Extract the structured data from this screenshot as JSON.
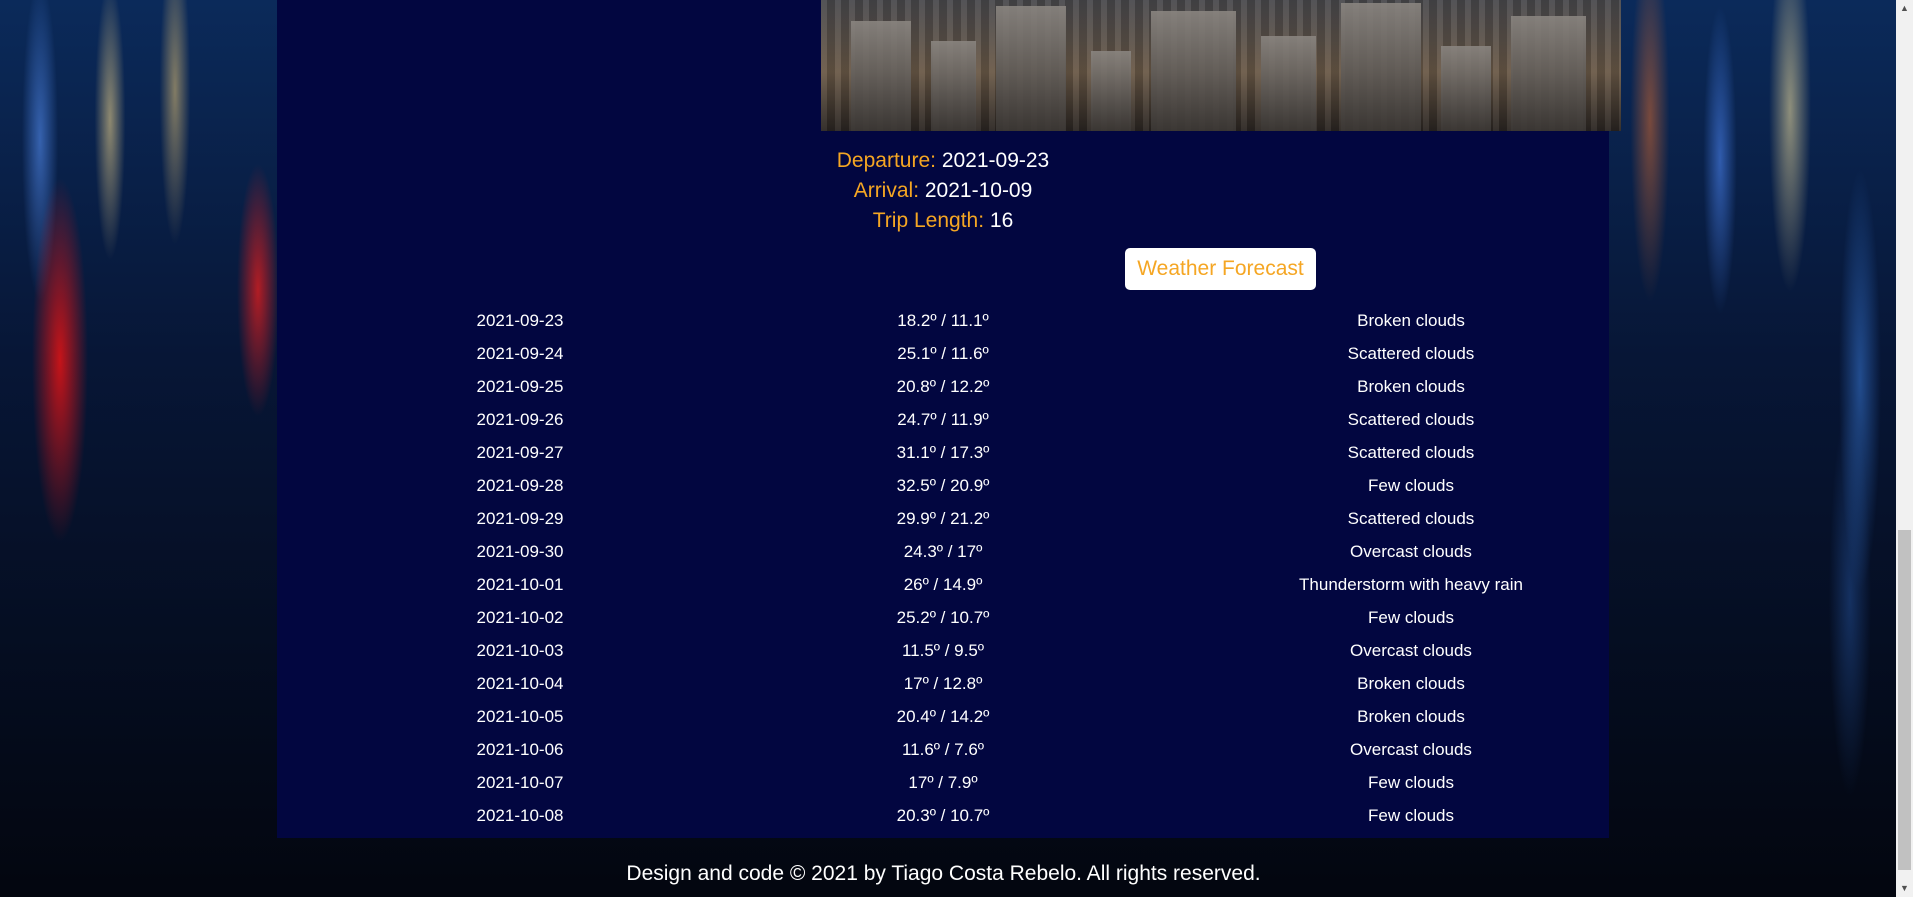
{
  "trip": {
    "departure_label": "Departure:",
    "departure_value": "2021-09-23",
    "arrival_label": "Arrival:",
    "arrival_value": "2021-10-09",
    "length_label": "Trip Length:",
    "length_value": "16"
  },
  "forecast_button": "Weather Forecast",
  "forecast": [
    {
      "date": "2021-09-23",
      "temp": "18.2º / 11.1º",
      "desc": "Broken clouds"
    },
    {
      "date": "2021-09-24",
      "temp": "25.1º / 11.6º",
      "desc": "Scattered clouds"
    },
    {
      "date": "2021-09-25",
      "temp": "20.8º / 12.2º",
      "desc": "Broken clouds"
    },
    {
      "date": "2021-09-26",
      "temp": "24.7º / 11.9º",
      "desc": "Scattered clouds"
    },
    {
      "date": "2021-09-27",
      "temp": "31.1º / 17.3º",
      "desc": "Scattered clouds"
    },
    {
      "date": "2021-09-28",
      "temp": "32.5º / 20.9º",
      "desc": "Few clouds"
    },
    {
      "date": "2021-09-29",
      "temp": "29.9º / 21.2º",
      "desc": "Scattered clouds"
    },
    {
      "date": "2021-09-30",
      "temp": "24.3º / 17º",
      "desc": "Overcast clouds"
    },
    {
      "date": "2021-10-01",
      "temp": "26º / 14.9º",
      "desc": "Thunderstorm with heavy rain"
    },
    {
      "date": "2021-10-02",
      "temp": "25.2º / 10.7º",
      "desc": "Few clouds"
    },
    {
      "date": "2021-10-03",
      "temp": "11.5º / 9.5º",
      "desc": "Overcast clouds"
    },
    {
      "date": "2021-10-04",
      "temp": "17º / 12.8º",
      "desc": "Broken clouds"
    },
    {
      "date": "2021-10-05",
      "temp": "20.4º / 14.2º",
      "desc": "Broken clouds"
    },
    {
      "date": "2021-10-06",
      "temp": "11.6º / 7.6º",
      "desc": "Overcast clouds"
    },
    {
      "date": "2021-10-07",
      "temp": "17º / 7.9º",
      "desc": "Few clouds"
    },
    {
      "date": "2021-10-08",
      "temp": "20.3º / 10.7º",
      "desc": "Few clouds"
    }
  ],
  "footer": "Design and code © 2021 by Tiago Costa Rebelo. All rights reserved.",
  "colors": {
    "accent": "#f5a623",
    "panel": "#020640"
  }
}
